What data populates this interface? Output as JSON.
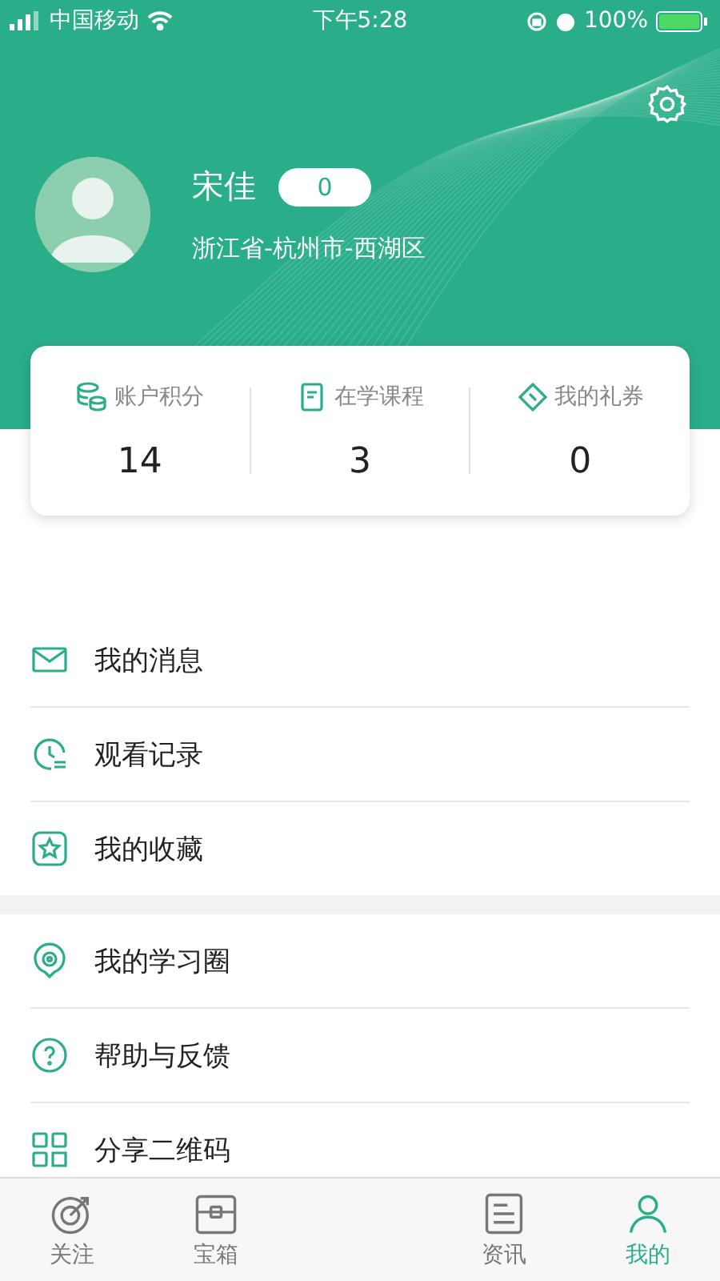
{
  "status_bar": {
    "carrier": "中国移动",
    "time": "下午5:28",
    "battery": "100%"
  },
  "profile": {
    "name": "宋佳",
    "badge": "0",
    "location": "浙江省-杭州市-西湖区"
  },
  "stats": [
    {
      "kind": "points",
      "label": "账户积分",
      "value": "14"
    },
    {
      "kind": "courses",
      "label": "在学课程",
      "value": "3"
    },
    {
      "kind": "coupons",
      "label": "我的礼券",
      "value": "0"
    }
  ],
  "menu_groups": [
    [
      {
        "kind": "message",
        "label": "我的消息"
      },
      {
        "kind": "history",
        "label": "观看记录"
      },
      {
        "kind": "favorite",
        "label": "我的收藏"
      }
    ],
    [
      {
        "kind": "circle",
        "label": "我的学习圈"
      },
      {
        "kind": "help",
        "label": "帮助与反馈"
      },
      {
        "kind": "qrcode",
        "label": "分享二维码"
      }
    ]
  ],
  "tab_bar": [
    {
      "kind": "follow",
      "label": "关注",
      "selected": false
    },
    {
      "kind": "chest",
      "label": "宝箱",
      "selected": false
    },
    {
      "kind": "hidden"
    },
    {
      "kind": "news",
      "label": "资讯",
      "selected": false
    },
    {
      "kind": "me",
      "label": "我的",
      "selected": true
    }
  ]
}
